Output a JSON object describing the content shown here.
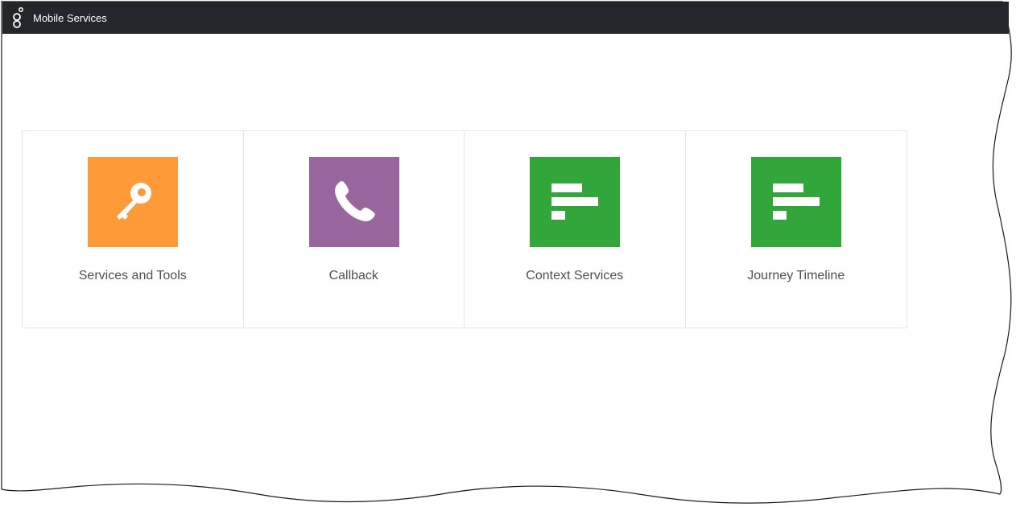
{
  "header": {
    "app_title": "Mobile Services",
    "logo_icon": "genesys-logo-icon",
    "background_color": "#23262b"
  },
  "tiles": [
    {
      "label": "Services and Tools",
      "icon": "key-icon",
      "color": "#fe9a38"
    },
    {
      "label": "Callback",
      "icon": "phone-icon",
      "color": "#98669d"
    },
    {
      "label": "Context Services",
      "icon": "bars-icon",
      "color": "#32a63a"
    },
    {
      "label": "Journey Timeline",
      "icon": "bars-icon",
      "color": "#32a63a"
    }
  ]
}
